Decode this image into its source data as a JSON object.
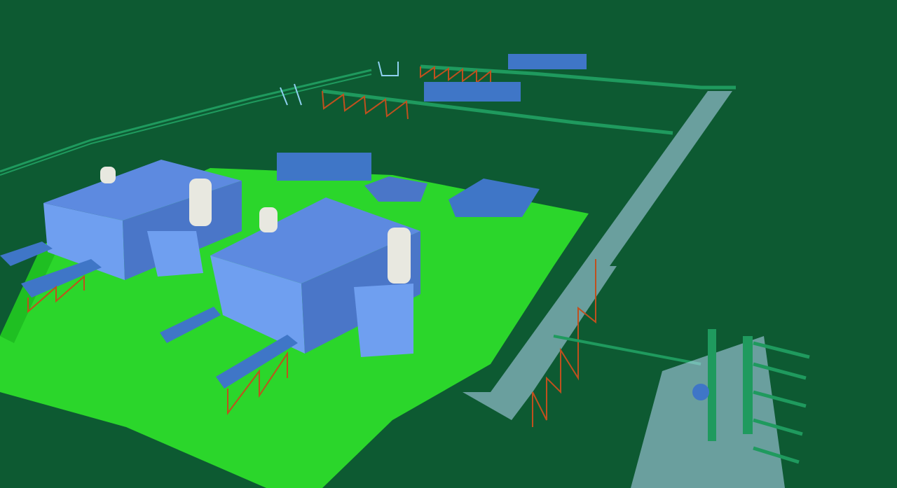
{
  "scene": {
    "subject": "3d-plant-model",
    "colors": {
      "background": "#0d5a32",
      "ground": "#2bd62b",
      "ground_dark": "#1fbf22",
      "building": "#6f9ff0",
      "building_dark": "#4a76c8",
      "roof": "#5d8ae0",
      "stack": "#e8e8e0",
      "pipe": "#1f9a5e",
      "pipe_light": "#8fd0f0",
      "rack_steel": "#b8d8f8",
      "support": "#c0501e",
      "cooler": "#3f76c7"
    },
    "objects": {
      "buildings": 2,
      "stacks": 4,
      "coolers": 4,
      "pipe_racks": 3,
      "process_units": 1
    }
  }
}
